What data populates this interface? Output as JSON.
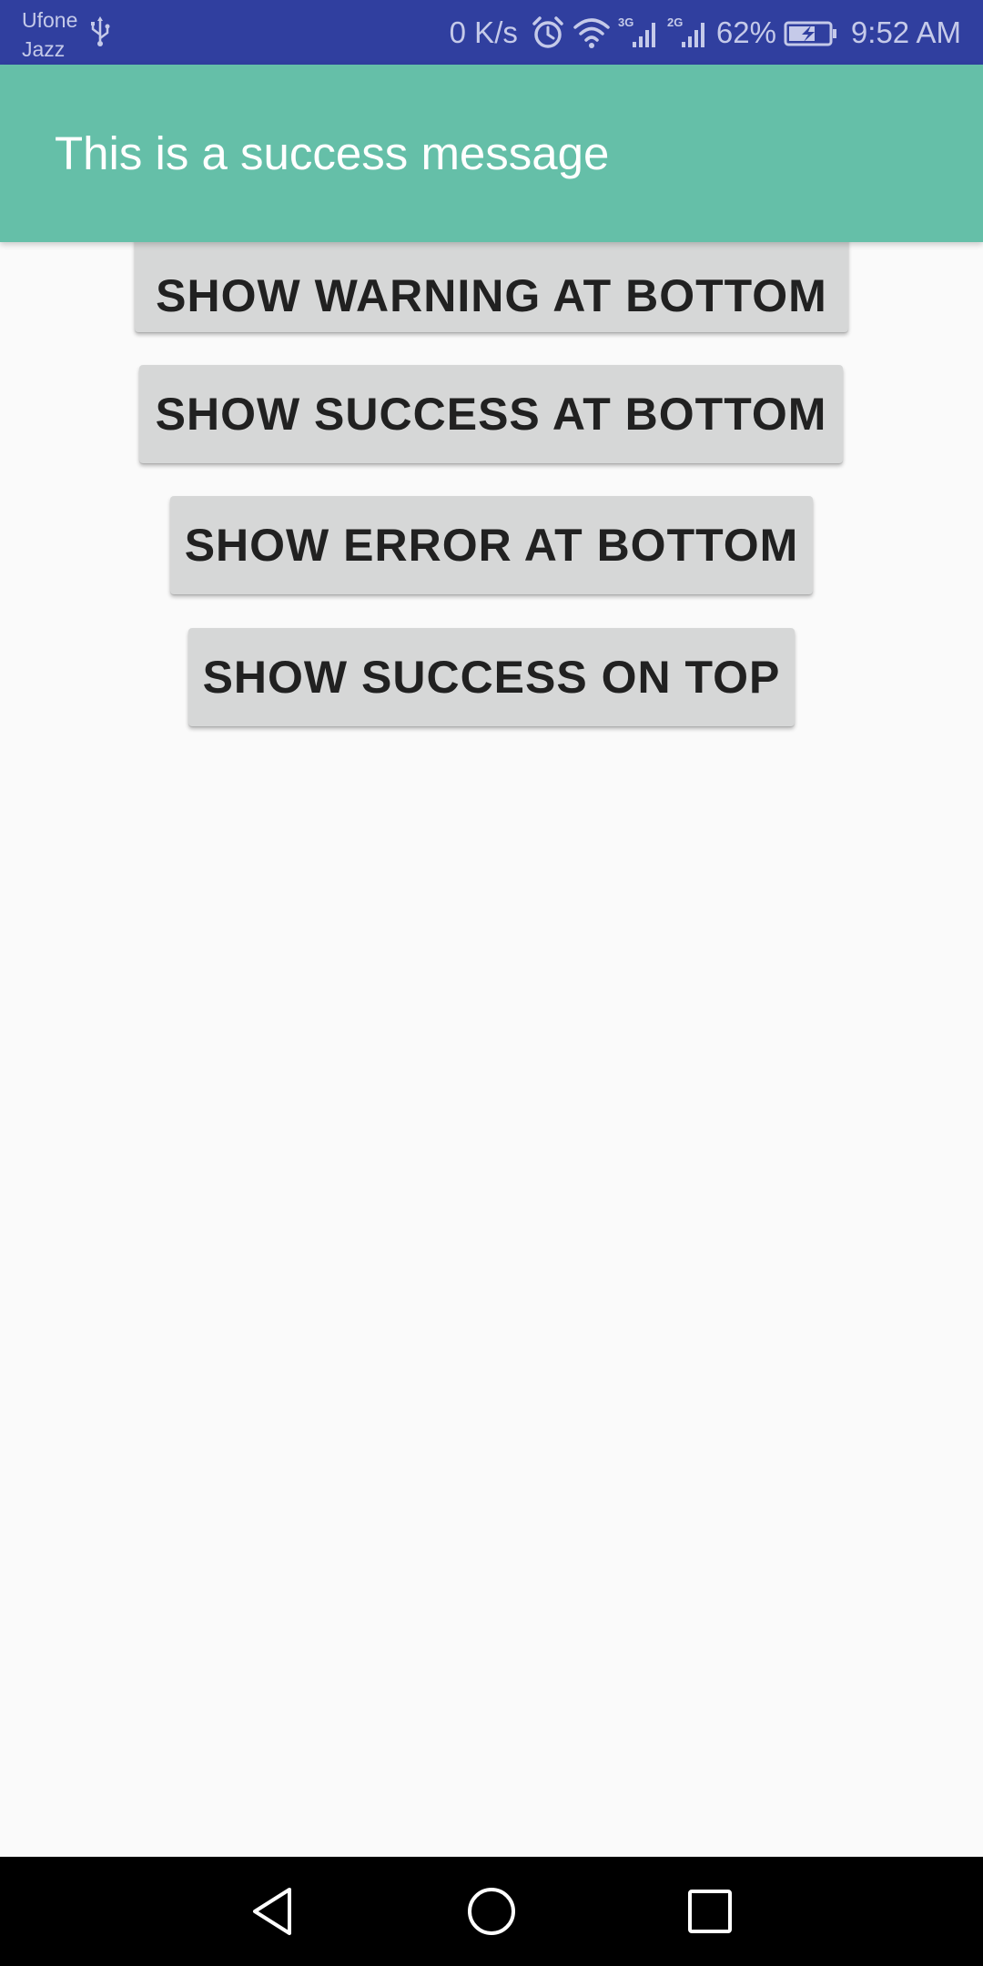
{
  "status_bar": {
    "carrier_line1": "Ufone",
    "carrier_line2": "Jazz",
    "net_speed": "0 K/s",
    "net_3g": "3G",
    "net_2g": "2G",
    "battery": "62%",
    "time": "9:52 AM",
    "icons": [
      "usb-icon",
      "alarm-icon",
      "wifi-icon",
      "signal-3g-icon",
      "signal-2g-icon",
      "battery-charging-icon"
    ]
  },
  "banner": {
    "message": "This is a success message",
    "color": "#65bfa8"
  },
  "buttons": {
    "warning_bottom": "SHOW WARNING AT BOTTOM",
    "success_bottom": "SHOW SUCCESS AT BOTTOM",
    "error_bottom": "SHOW ERROR AT BOTTOM",
    "success_top": "SHOW SUCCESS ON TOP"
  },
  "navigation": {
    "icons": [
      "back-icon",
      "home-icon",
      "recents-icon"
    ]
  },
  "colors": {
    "status_bar": "#303f9f",
    "button_bg": "#d6d7d7",
    "background": "#fafafa"
  }
}
